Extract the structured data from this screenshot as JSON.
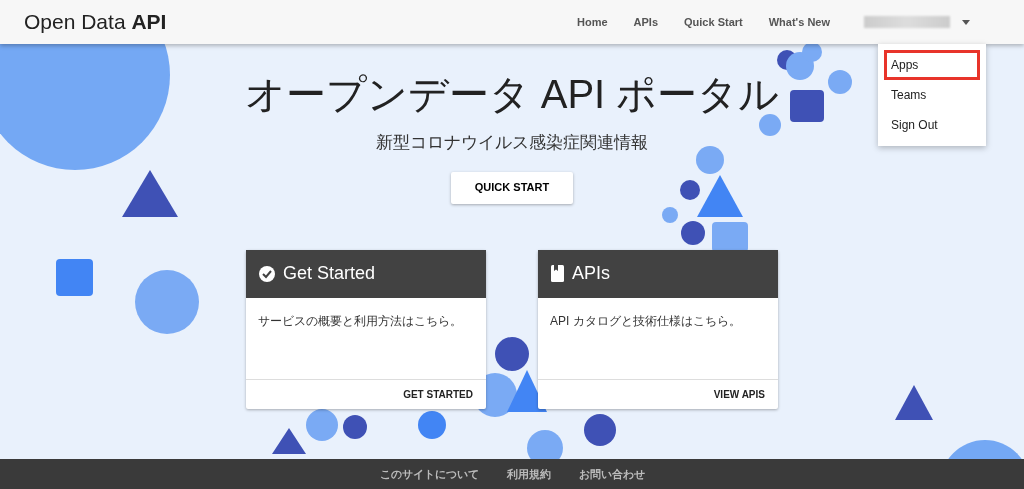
{
  "brand": {
    "text": "Open Data ",
    "bold": "API"
  },
  "nav": [
    {
      "label": "Home"
    },
    {
      "label": "APIs"
    },
    {
      "label": "Quick Start"
    },
    {
      "label": "What's New"
    }
  ],
  "user_menu": {
    "expanded": true,
    "items": [
      {
        "label": "Apps",
        "highlighted": true
      },
      {
        "label": "Teams",
        "highlighted": false
      },
      {
        "label": "Sign Out",
        "highlighted": false
      }
    ]
  },
  "hero": {
    "title": "オープンデータ API ポータル",
    "subtitle": "新型コロナウイルス感染症関連情報",
    "button": "QUICK START"
  },
  "cards": [
    {
      "kind": "check",
      "title": "Get Started",
      "body": "サービスの概要と利用方法はこちら。",
      "action": "GET STARTED"
    },
    {
      "kind": "book",
      "title": "APIs",
      "body": "API カタログと技術仕様はこちら。",
      "action": "VIEW APIS"
    }
  ],
  "footer": [
    {
      "label": "このサイトについて"
    },
    {
      "label": "利用規約"
    },
    {
      "label": "お問い合わせ"
    }
  ]
}
